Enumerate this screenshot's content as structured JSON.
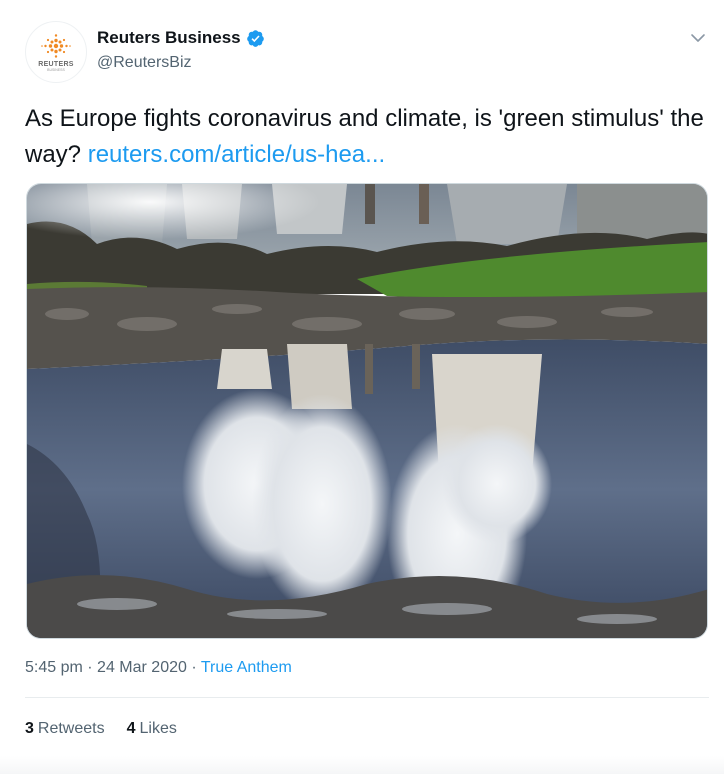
{
  "author": {
    "display_name": "Reuters Business",
    "handle": "@ReutersBiz",
    "verified": true,
    "avatar_word": "REUTERS",
    "avatar_sub": "BUSINESS"
  },
  "icons": {
    "verified": "verified-badge-icon",
    "more": "chevron-down-icon"
  },
  "tweet": {
    "text": "As Europe fights coronavirus and climate, is 'green stimulus' the way?",
    "link_text": "reuters.com/article/us-hea..."
  },
  "meta": {
    "time": "5:45 pm",
    "separator": "·",
    "date": "24 Mar 2020",
    "source": "True Anthem"
  },
  "stats": {
    "retweets_count": "3",
    "retweets_label": "Retweets",
    "likes_count": "4",
    "likes_label": "Likes"
  },
  "colors": {
    "accent": "#1d9bf0",
    "text": "#0f1419",
    "secondary": "#536471",
    "avatar_orange": "#f08a24"
  }
}
